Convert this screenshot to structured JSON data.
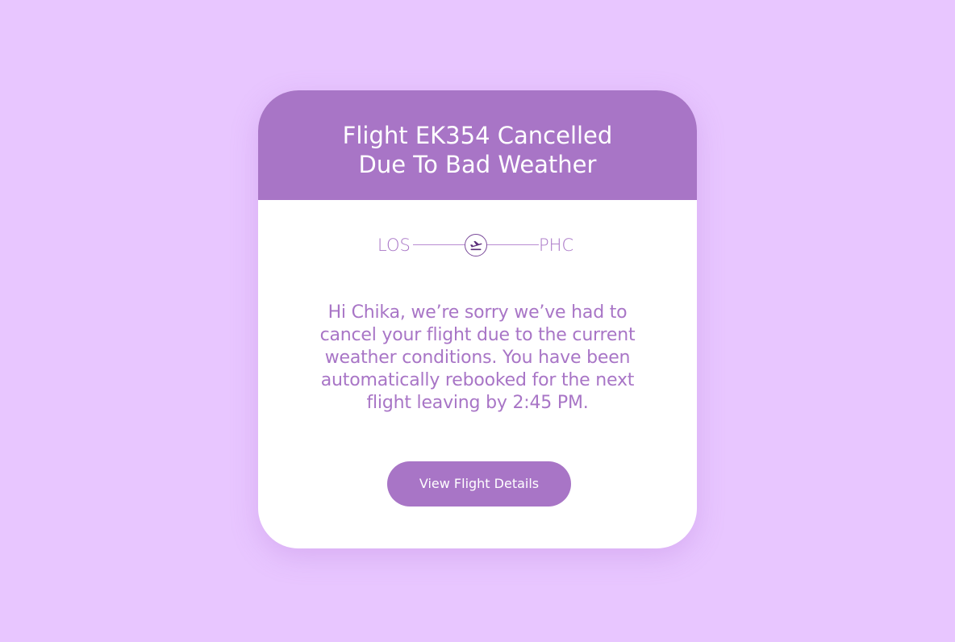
{
  "notification": {
    "title_line_1": "Flight EK354 Cancelled",
    "title_line_2": "Due To Bad Weather",
    "route": {
      "from": "LOS",
      "to": "PHC",
      "icon": "plane-departure-icon"
    },
    "message_lines": [
      "Hi Chika, we’re sorry we’ve had to",
      "cancel your flight due to the current",
      "weather conditions. You have been",
      "automatically rebooked for the next",
      "flight leaving by 2:45 PM."
    ],
    "cta_label": "View Flight Details"
  },
  "colors": {
    "background": "#e8c6ff",
    "accent": "#a875c6",
    "card": "#ffffff",
    "icon": "#5b2e7a"
  }
}
